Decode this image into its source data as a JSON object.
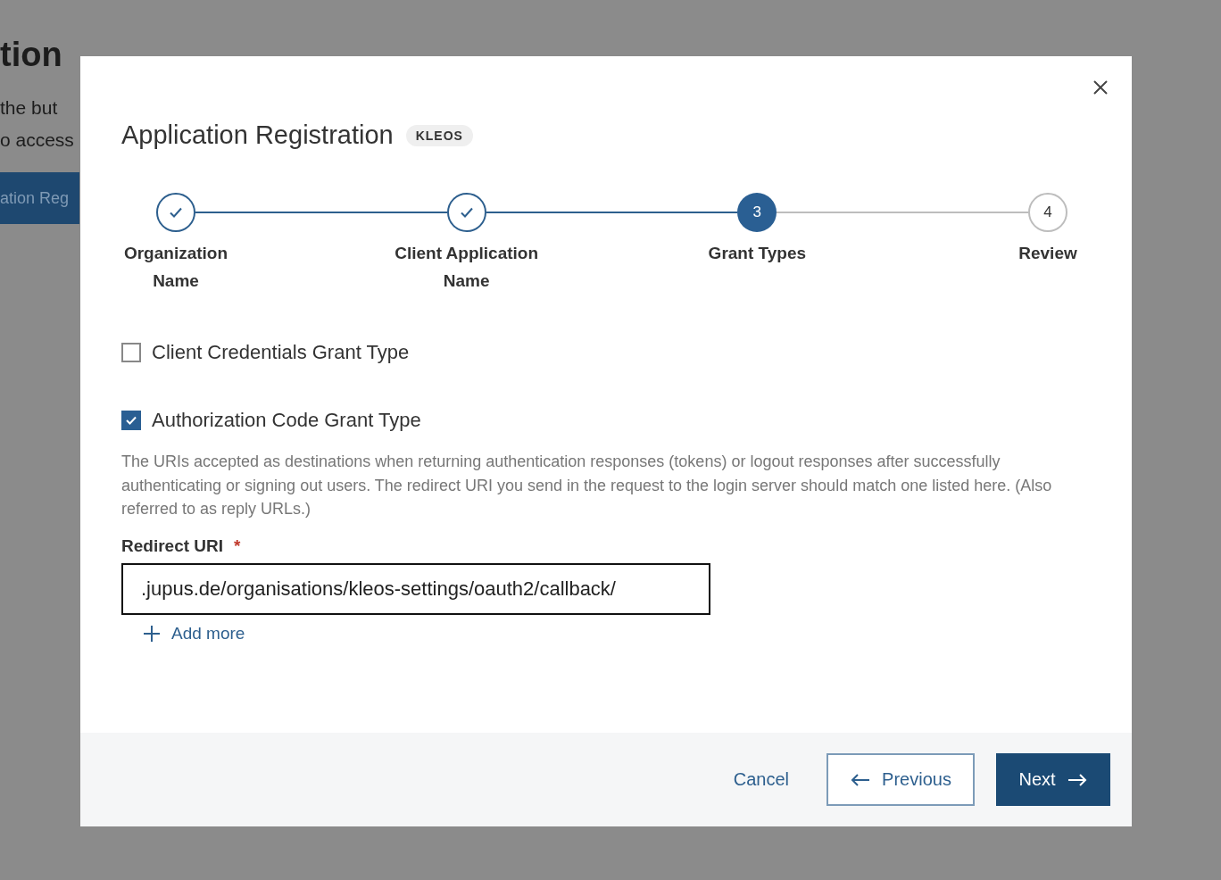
{
  "background_page": {
    "heading": "tion",
    "lines": [
      "the but",
      "o access"
    ],
    "button": "ation Reg"
  },
  "dialog": {
    "title": "Application Registration",
    "badge": "KLEOS",
    "steps": [
      {
        "label": "Organization Name",
        "kind": "complete"
      },
      {
        "label": "Client Application Name",
        "kind": "complete"
      },
      {
        "number": "3",
        "label": "Grant Types",
        "kind": "current"
      },
      {
        "number": "4",
        "label": "Review",
        "kind": "upcoming"
      }
    ],
    "options": [
      {
        "label": "Client Credentials Grant Type",
        "checked": false
      },
      {
        "label": "Authorization Code Grant Type",
        "checked": true
      }
    ],
    "description": "The URIs accepted as destinations when returning authentication responses (tokens) or logout responses after successfully authenticating or signing out users. The redirect URI you send in the request to the login server should match one listed here. (Also referred to as reply URLs.)",
    "field": {
      "label": "Redirect URI",
      "required_mark": "*",
      "value": ".jupus.de/organisations/kleos-settings/oauth2/callback/"
    },
    "add_more": "Add more",
    "buttons": {
      "cancel": "Cancel",
      "previous": "Previous",
      "next": "Next"
    }
  }
}
